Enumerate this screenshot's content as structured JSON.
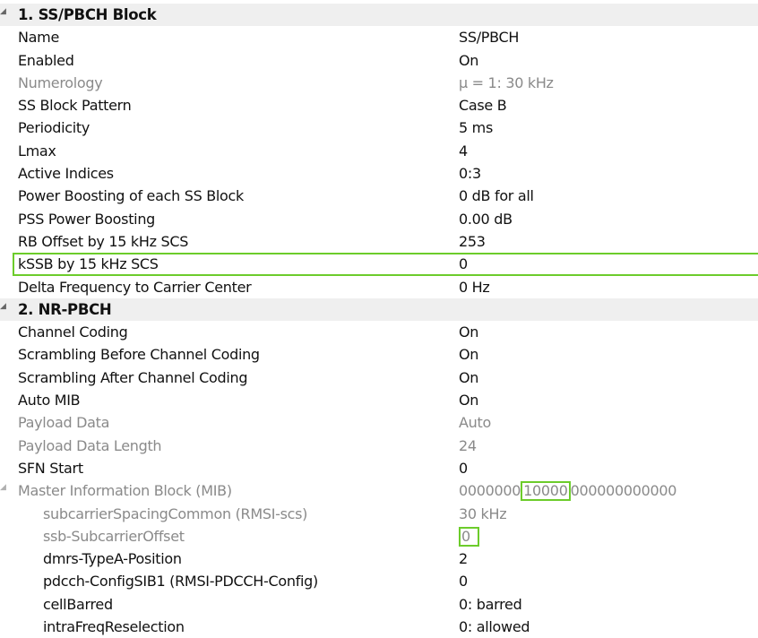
{
  "sections": [
    {
      "title": "1. SS/PBCH Block",
      "rows": [
        {
          "name": "Name",
          "value": "SS/PBCH",
          "dim": false
        },
        {
          "name": "Enabled",
          "value": "On",
          "dim": false
        },
        {
          "name": "Numerology",
          "value": "μ = 1: 30 kHz",
          "dim": true
        },
        {
          "name": "SS Block Pattern",
          "value": "Case B",
          "dim": false
        },
        {
          "name": "Periodicity",
          "value": "5 ms",
          "dim": false
        },
        {
          "name": "Lmax",
          "value": "4",
          "dim": false
        },
        {
          "name": "Active Indices",
          "value": "0:3",
          "dim": false
        },
        {
          "name": "Power Boosting of each SS Block",
          "value": "0 dB for all",
          "dim": false
        },
        {
          "name": "PSS Power Boosting",
          "value": "0.00 dB",
          "dim": false
        },
        {
          "name": "RB Offset by 15 kHz SCS",
          "value": "253",
          "dim": false
        },
        {
          "name": "kSSB by 15 kHz SCS",
          "value": "0",
          "dim": false,
          "highlighted": true
        },
        {
          "name": "Delta Frequency to Carrier Center",
          "value": "0 Hz",
          "dim": false
        }
      ]
    },
    {
      "title": "2. NR-PBCH",
      "rows": [
        {
          "name": "Channel Coding",
          "value": "On",
          "dim": false
        },
        {
          "name": "Scrambling Before Channel Coding",
          "value": "On",
          "dim": false
        },
        {
          "name": "Scrambling After Channel Coding",
          "value": "On",
          "dim": false
        },
        {
          "name": "Auto MIB",
          "value": "On",
          "dim": false
        },
        {
          "name": "Payload Data",
          "value": "Auto",
          "dim": true
        },
        {
          "name": "Payload Data Length",
          "value": "24",
          "dim": true
        },
        {
          "name": "SFN Start",
          "value": "0",
          "dim": false
        },
        {
          "name": "Master Information Block (MIB)",
          "value_parts": {
            "pre": "0000000",
            "boxed": "10000",
            "post": "000000000000"
          },
          "dim": true
        },
        {
          "name": "subcarrierSpacingCommon (RMSI-scs)",
          "value": "30 kHz",
          "dim": true
        },
        {
          "name": "ssb-SubcarrierOffset",
          "value": "0",
          "dim": true
        },
        {
          "name": "dmrs-TypeA-Position",
          "value": "2",
          "dim": false
        },
        {
          "name": "pdcch-ConfigSIB1 (RMSI-PDCCH-Config)",
          "value": "0",
          "dim": false
        },
        {
          "name": "cellBarred",
          "value": "0: barred",
          "dim": false
        },
        {
          "name": "intraFreqReselection",
          "value": "0: allowed",
          "dim": false
        }
      ]
    }
  ],
  "colors": {
    "highlight": "#6ccc2b",
    "dimmed_text": "#8a8a8a",
    "section_bg": "#efefef"
  },
  "icons": {
    "expander": "expand-caret-icon"
  }
}
